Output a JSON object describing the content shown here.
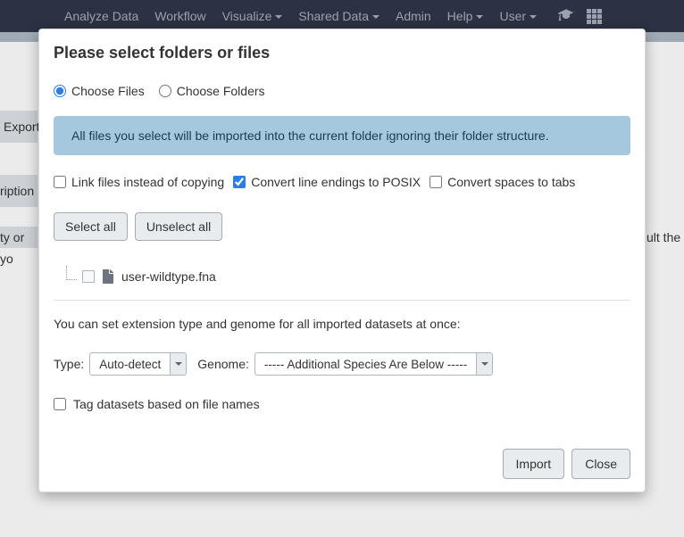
{
  "navbar": {
    "items": [
      {
        "label": "Analyze Data",
        "dropdown": false
      },
      {
        "label": "Workflow",
        "dropdown": false
      },
      {
        "label": "Visualize",
        "dropdown": true
      },
      {
        "label": "Shared Data",
        "dropdown": true
      },
      {
        "label": "Admin",
        "dropdown": false
      },
      {
        "label": "Help",
        "dropdown": true
      },
      {
        "label": "User",
        "dropdown": true
      }
    ]
  },
  "background": {
    "export": "Export",
    "description": "ription",
    "empty_left": "ty or yo",
    "empty_right": "ult the"
  },
  "modal": {
    "title": "Please select folders or files",
    "radio_files": "Choose Files",
    "radio_folders": "Choose Folders",
    "alert_text": "All files you select will be imported into the current folder ignoring their folder structure.",
    "checkbox_link": "Link files instead of copying",
    "checkbox_posix": "Convert line endings to POSIX",
    "checkbox_tabs": "Convert spaces to tabs",
    "select_all": "Select all",
    "unselect_all": "Unselect all",
    "file_name": "user-wildtype.fna",
    "extension_info": "You can set extension type and genome for all imported datasets at once:",
    "type_label": "Type:",
    "type_value": "Auto-detect",
    "genome_label": "Genome:",
    "genome_value": "----- Additional Species Are Below -----",
    "tag_checkbox": "Tag datasets based on file names",
    "import_btn": "Import",
    "close_btn": "Close"
  }
}
